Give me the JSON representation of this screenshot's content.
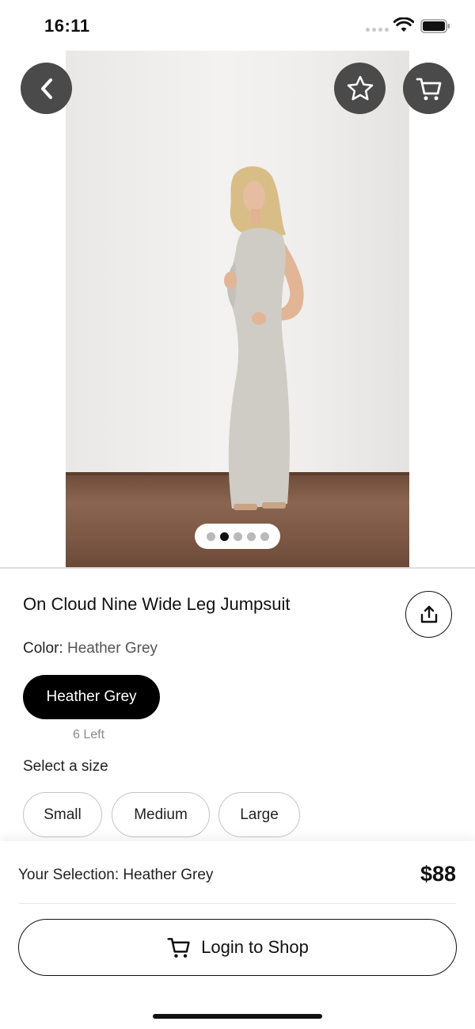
{
  "status_bar": {
    "time": "16:11",
    "icons": [
      "signal-dots-icon",
      "wifi-icon",
      "battery-icon"
    ]
  },
  "top_bar": {
    "back_icon": "chevron-left-icon",
    "favorite_icon": "star-icon",
    "cart_icon": "cart-icon"
  },
  "gallery": {
    "image_count": 5,
    "active_index": 1
  },
  "product": {
    "title": "On Cloud Nine Wide Leg Jumpsuit",
    "share_icon": "share-icon",
    "color_label": "Color:",
    "color_value": "Heather Grey",
    "color_options": [
      {
        "label": "Heather Grey",
        "stock": "6 Left",
        "selected": true
      }
    ],
    "size_label": "Select a size",
    "sizes": [
      "Small",
      "Medium",
      "Large"
    ]
  },
  "checkout": {
    "selection_text": "Your Selection: Heather Grey",
    "price": "$88",
    "button_label": "Login to Shop",
    "button_icon": "cart-icon"
  },
  "colors": {
    "accent": "#000000",
    "button_overlay": "#4a4a4a",
    "floor": "#7b5744"
  }
}
